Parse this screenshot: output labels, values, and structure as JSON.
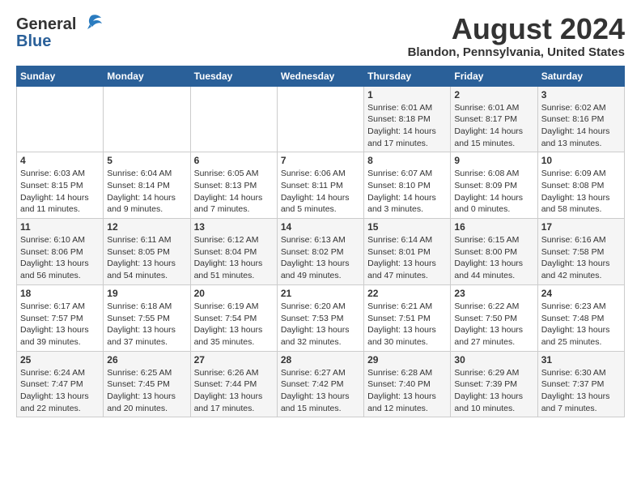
{
  "logo": {
    "line1": "General",
    "line2": "Blue"
  },
  "title": "August 2024",
  "subtitle": "Blandon, Pennsylvania, United States",
  "weekdays": [
    "Sunday",
    "Monday",
    "Tuesday",
    "Wednesday",
    "Thursday",
    "Friday",
    "Saturday"
  ],
  "weeks": [
    [
      {
        "day": "",
        "info": ""
      },
      {
        "day": "",
        "info": ""
      },
      {
        "day": "",
        "info": ""
      },
      {
        "day": "",
        "info": ""
      },
      {
        "day": "1",
        "info": "Sunrise: 6:01 AM\nSunset: 8:18 PM\nDaylight: 14 hours\nand 17 minutes."
      },
      {
        "day": "2",
        "info": "Sunrise: 6:01 AM\nSunset: 8:17 PM\nDaylight: 14 hours\nand 15 minutes."
      },
      {
        "day": "3",
        "info": "Sunrise: 6:02 AM\nSunset: 8:16 PM\nDaylight: 14 hours\nand 13 minutes."
      }
    ],
    [
      {
        "day": "4",
        "info": "Sunrise: 6:03 AM\nSunset: 8:15 PM\nDaylight: 14 hours\nand 11 minutes."
      },
      {
        "day": "5",
        "info": "Sunrise: 6:04 AM\nSunset: 8:14 PM\nDaylight: 14 hours\nand 9 minutes."
      },
      {
        "day": "6",
        "info": "Sunrise: 6:05 AM\nSunset: 8:13 PM\nDaylight: 14 hours\nand 7 minutes."
      },
      {
        "day": "7",
        "info": "Sunrise: 6:06 AM\nSunset: 8:11 PM\nDaylight: 14 hours\nand 5 minutes."
      },
      {
        "day": "8",
        "info": "Sunrise: 6:07 AM\nSunset: 8:10 PM\nDaylight: 14 hours\nand 3 minutes."
      },
      {
        "day": "9",
        "info": "Sunrise: 6:08 AM\nSunset: 8:09 PM\nDaylight: 14 hours\nand 0 minutes."
      },
      {
        "day": "10",
        "info": "Sunrise: 6:09 AM\nSunset: 8:08 PM\nDaylight: 13 hours\nand 58 minutes."
      }
    ],
    [
      {
        "day": "11",
        "info": "Sunrise: 6:10 AM\nSunset: 8:06 PM\nDaylight: 13 hours\nand 56 minutes."
      },
      {
        "day": "12",
        "info": "Sunrise: 6:11 AM\nSunset: 8:05 PM\nDaylight: 13 hours\nand 54 minutes."
      },
      {
        "day": "13",
        "info": "Sunrise: 6:12 AM\nSunset: 8:04 PM\nDaylight: 13 hours\nand 51 minutes."
      },
      {
        "day": "14",
        "info": "Sunrise: 6:13 AM\nSunset: 8:02 PM\nDaylight: 13 hours\nand 49 minutes."
      },
      {
        "day": "15",
        "info": "Sunrise: 6:14 AM\nSunset: 8:01 PM\nDaylight: 13 hours\nand 47 minutes."
      },
      {
        "day": "16",
        "info": "Sunrise: 6:15 AM\nSunset: 8:00 PM\nDaylight: 13 hours\nand 44 minutes."
      },
      {
        "day": "17",
        "info": "Sunrise: 6:16 AM\nSunset: 7:58 PM\nDaylight: 13 hours\nand 42 minutes."
      }
    ],
    [
      {
        "day": "18",
        "info": "Sunrise: 6:17 AM\nSunset: 7:57 PM\nDaylight: 13 hours\nand 39 minutes."
      },
      {
        "day": "19",
        "info": "Sunrise: 6:18 AM\nSunset: 7:55 PM\nDaylight: 13 hours\nand 37 minutes."
      },
      {
        "day": "20",
        "info": "Sunrise: 6:19 AM\nSunset: 7:54 PM\nDaylight: 13 hours\nand 35 minutes."
      },
      {
        "day": "21",
        "info": "Sunrise: 6:20 AM\nSunset: 7:53 PM\nDaylight: 13 hours\nand 32 minutes."
      },
      {
        "day": "22",
        "info": "Sunrise: 6:21 AM\nSunset: 7:51 PM\nDaylight: 13 hours\nand 30 minutes."
      },
      {
        "day": "23",
        "info": "Sunrise: 6:22 AM\nSunset: 7:50 PM\nDaylight: 13 hours\nand 27 minutes."
      },
      {
        "day": "24",
        "info": "Sunrise: 6:23 AM\nSunset: 7:48 PM\nDaylight: 13 hours\nand 25 minutes."
      }
    ],
    [
      {
        "day": "25",
        "info": "Sunrise: 6:24 AM\nSunset: 7:47 PM\nDaylight: 13 hours\nand 22 minutes."
      },
      {
        "day": "26",
        "info": "Sunrise: 6:25 AM\nSunset: 7:45 PM\nDaylight: 13 hours\nand 20 minutes."
      },
      {
        "day": "27",
        "info": "Sunrise: 6:26 AM\nSunset: 7:44 PM\nDaylight: 13 hours\nand 17 minutes."
      },
      {
        "day": "28",
        "info": "Sunrise: 6:27 AM\nSunset: 7:42 PM\nDaylight: 13 hours\nand 15 minutes."
      },
      {
        "day": "29",
        "info": "Sunrise: 6:28 AM\nSunset: 7:40 PM\nDaylight: 13 hours\nand 12 minutes."
      },
      {
        "day": "30",
        "info": "Sunrise: 6:29 AM\nSunset: 7:39 PM\nDaylight: 13 hours\nand 10 minutes."
      },
      {
        "day": "31",
        "info": "Sunrise: 6:30 AM\nSunset: 7:37 PM\nDaylight: 13 hours\nand 7 minutes."
      }
    ]
  ]
}
